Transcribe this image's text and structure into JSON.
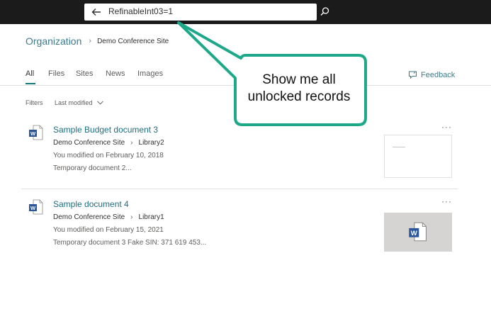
{
  "search": {
    "query": "RefinableInt03=1"
  },
  "breadcrumb": {
    "organization": "Organization",
    "separator": "›",
    "site": "Demo Conference Site"
  },
  "tabs": [
    {
      "label": "All",
      "active": true
    },
    {
      "label": "Files"
    },
    {
      "label": "Sites"
    },
    {
      "label": "News"
    },
    {
      "label": "Images"
    }
  ],
  "feedback": {
    "label": "Feedback"
  },
  "filters": {
    "label": "Filters",
    "last_modified": "Last modified"
  },
  "results": [
    {
      "title": "Sample Budget document 3",
      "site": "Demo Conference Site",
      "library": "Library2",
      "modified": "You modified on February 10, 2018",
      "snippet": "Temporary document 2..."
    },
    {
      "title": "Sample document 4",
      "site": "Demo Conference Site",
      "library": "Library1",
      "modified": "You modified on February 15, 2021",
      "snippet": "Temporary document 3 Fake SIN: 371 619 453..."
    }
  ],
  "more_label": "···",
  "path_separator": "›",
  "callout": {
    "line1": "Show me all",
    "line2": "unlocked records"
  },
  "colors": {
    "accent": "#127a7a",
    "callout_border": "#1ea88a",
    "topbar": "#1b1b1b",
    "word_blue": "#2b579a"
  }
}
